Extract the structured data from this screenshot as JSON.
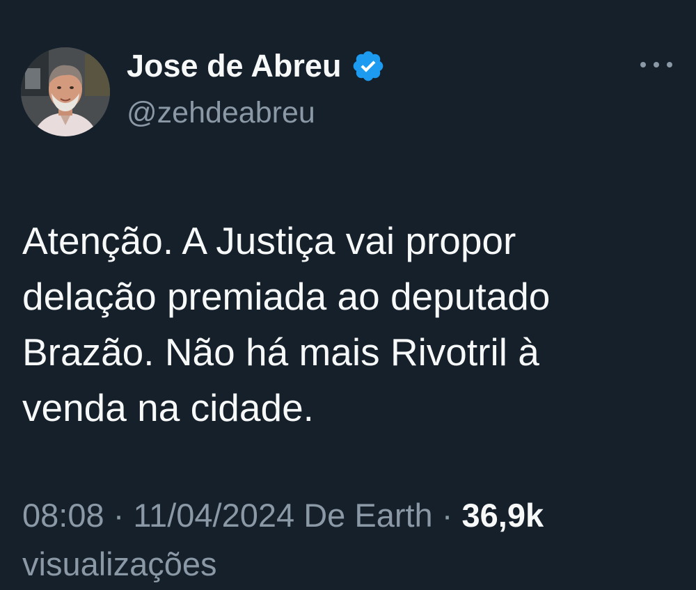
{
  "author": {
    "display_name": "Jose de Abreu",
    "handle": "@zehdeabreu",
    "verified": true,
    "avatar_icon": "profile-photo"
  },
  "menu": {
    "icon": "more-horizontal-icon"
  },
  "tweet": {
    "lines": [
      "Atenção. A Justiça vai propor",
      "delação premiada ao deputado",
      "Brazão. Não há mais Rivotril à",
      "venda na cidade."
    ]
  },
  "meta": {
    "time": "08:08",
    "date": "11/04/2024",
    "location": "De Earth",
    "separator": "·",
    "views_count": "36,9k",
    "views_label": "visualizações"
  },
  "colors": {
    "background": "#15202b",
    "text_primary": "#f7f9f9",
    "text_secondary": "#8b98a5",
    "verified_blue": "#1d9bf0"
  }
}
